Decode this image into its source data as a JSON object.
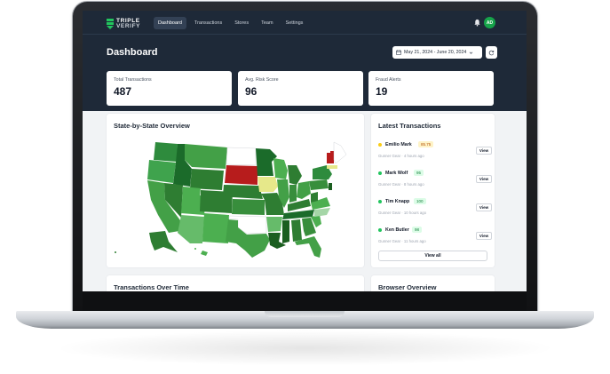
{
  "nav": {
    "logo_line1": "TRIPLE",
    "logo_line2": "VERIFY",
    "links": [
      {
        "label": "Dashboard",
        "active": true
      },
      {
        "label": "Transactions"
      },
      {
        "label": "Stores"
      },
      {
        "label": "Team"
      },
      {
        "label": "Settings"
      }
    ],
    "avatar_initials": "AD"
  },
  "header": {
    "title": "Dashboard",
    "date_range": "May 21, 2024 - June 20, 2024"
  },
  "stats": [
    {
      "label": "Total Transactions",
      "value": "487"
    },
    {
      "label": "Avg. Risk Score",
      "value": "96"
    },
    {
      "label": "Fraud Alerts",
      "value": "19"
    }
  ],
  "map_card": {
    "title": "State-by-State Overview"
  },
  "transactions_card": {
    "title": "Latest Transactions",
    "rows": [
      {
        "name": "Emilio Mark",
        "score": "85.75",
        "store": "Gunner Gear",
        "time": "4 hours ago",
        "level": "warn",
        "view": "View"
      },
      {
        "name": "Mark Wolf",
        "score": "95",
        "store": "Gunner Gear",
        "time": "8 hours ago",
        "level": "ok",
        "view": "View"
      },
      {
        "name": "Tim Knapp",
        "score": "100",
        "store": "Gunner Gear",
        "time": "10 hours ago",
        "level": "ok",
        "view": "View"
      },
      {
        "name": "Ken Butler",
        "score": "98",
        "store": "Gunner Gear",
        "time": "11 hours ago",
        "level": "ok",
        "view": "View"
      }
    ],
    "view_all": "View all"
  },
  "bottom_cards": {
    "left_title": "Transactions Over Time",
    "right_title": "Browser Overview"
  },
  "colors": {
    "nav_bg": "#1e2938",
    "brand_green": "#16a34a",
    "warn": "#facc15",
    "danger": "#b91c1c",
    "caution": "#e6e88a"
  },
  "icons": [
    "calendar-icon",
    "chevron-down-icon",
    "refresh-icon",
    "bell-icon",
    "logo-icon"
  ]
}
